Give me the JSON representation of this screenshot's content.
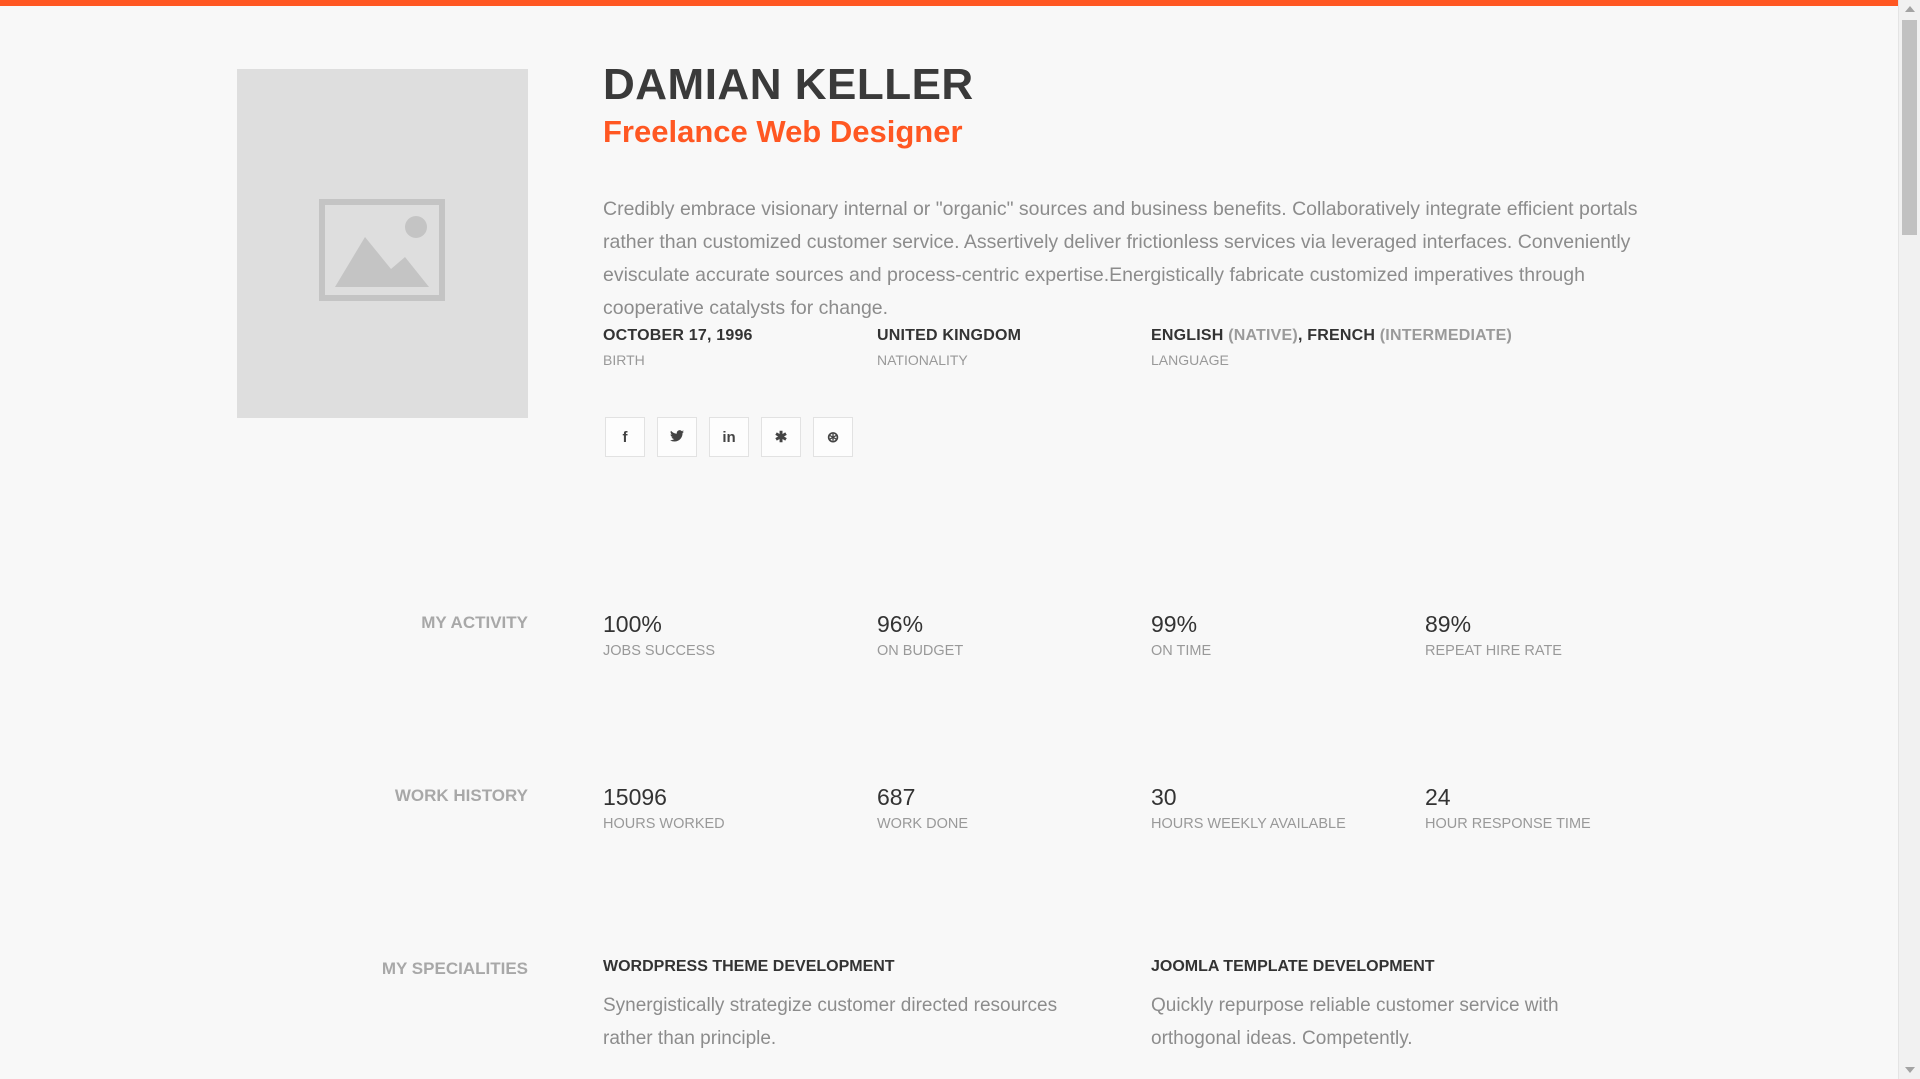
{
  "profile": {
    "name": "DAMIAN KELLER",
    "role": "Freelance Web Designer",
    "bio": "Credibly embrace visionary internal or \"organic\" sources and business benefits. Collaboratively integrate efficient portals rather than customized customer service. Assertively deliver frictionless services via leveraged interfaces. Conveniently evisculate accurate sources and process-centric expertise.Energistically fabricate customized imperatives through cooperative catalysts for change.",
    "photo_icon": "image-placeholder-icon"
  },
  "info": {
    "birth": {
      "value": "OCTOBER 17, 1996",
      "label": "BIRTH"
    },
    "nationality": {
      "value": "UNITED KINGDOM",
      "label": "NATIONALITY"
    },
    "language": {
      "lang1": "ENGLISH",
      "level1": "(NATIVE)",
      "separator": ",",
      "lang2": "FRENCH",
      "level2": "(INTERMEDIATE)",
      "label": "LANGUAGE"
    }
  },
  "socials": [
    {
      "icon": "facebook-icon",
      "glyph": "f"
    },
    {
      "icon": "twitter-icon",
      "glyph": "🐦"
    },
    {
      "icon": "linkedin-icon",
      "glyph": "in"
    },
    {
      "icon": "slack-icon",
      "glyph": "✱"
    },
    {
      "icon": "dribbble-icon",
      "glyph": "⊛"
    }
  ],
  "activity": {
    "label": "MY ACTIVITY",
    "stats": [
      {
        "value": "100%",
        "label": "JOBS SUCCESS"
      },
      {
        "value": "96%",
        "label": "ON BUDGET"
      },
      {
        "value": "99%",
        "label": "ON TIME"
      },
      {
        "value": "89%",
        "label": "REPEAT HIRE RATE"
      }
    ]
  },
  "work_history": {
    "label": "WORK HISTORY",
    "stats": [
      {
        "value": "15096",
        "label": "HOURS WORKED"
      },
      {
        "value": "687",
        "label": "WORK DONE"
      },
      {
        "value": "30",
        "label": "HOURS WEEKLY AVAILABLE"
      },
      {
        "value": "24",
        "label": "HOUR RESPONSE TIME"
      }
    ]
  },
  "specialities": {
    "label": "MY SPECIALITIES",
    "items": [
      {
        "title": "WORDPRESS THEME DEVELOPMENT",
        "desc": "Synergistically strategize customer directed resources rather than principle."
      },
      {
        "title": "JOOMLA TEMPLATE DEVELOPMENT",
        "desc": "Quickly repurpose reliable customer service with orthogonal ideas. Competently."
      }
    ]
  },
  "colors": {
    "accent": "#ff5722",
    "text": "#333333",
    "muted": "#999999",
    "background": "#f8f8f8"
  }
}
